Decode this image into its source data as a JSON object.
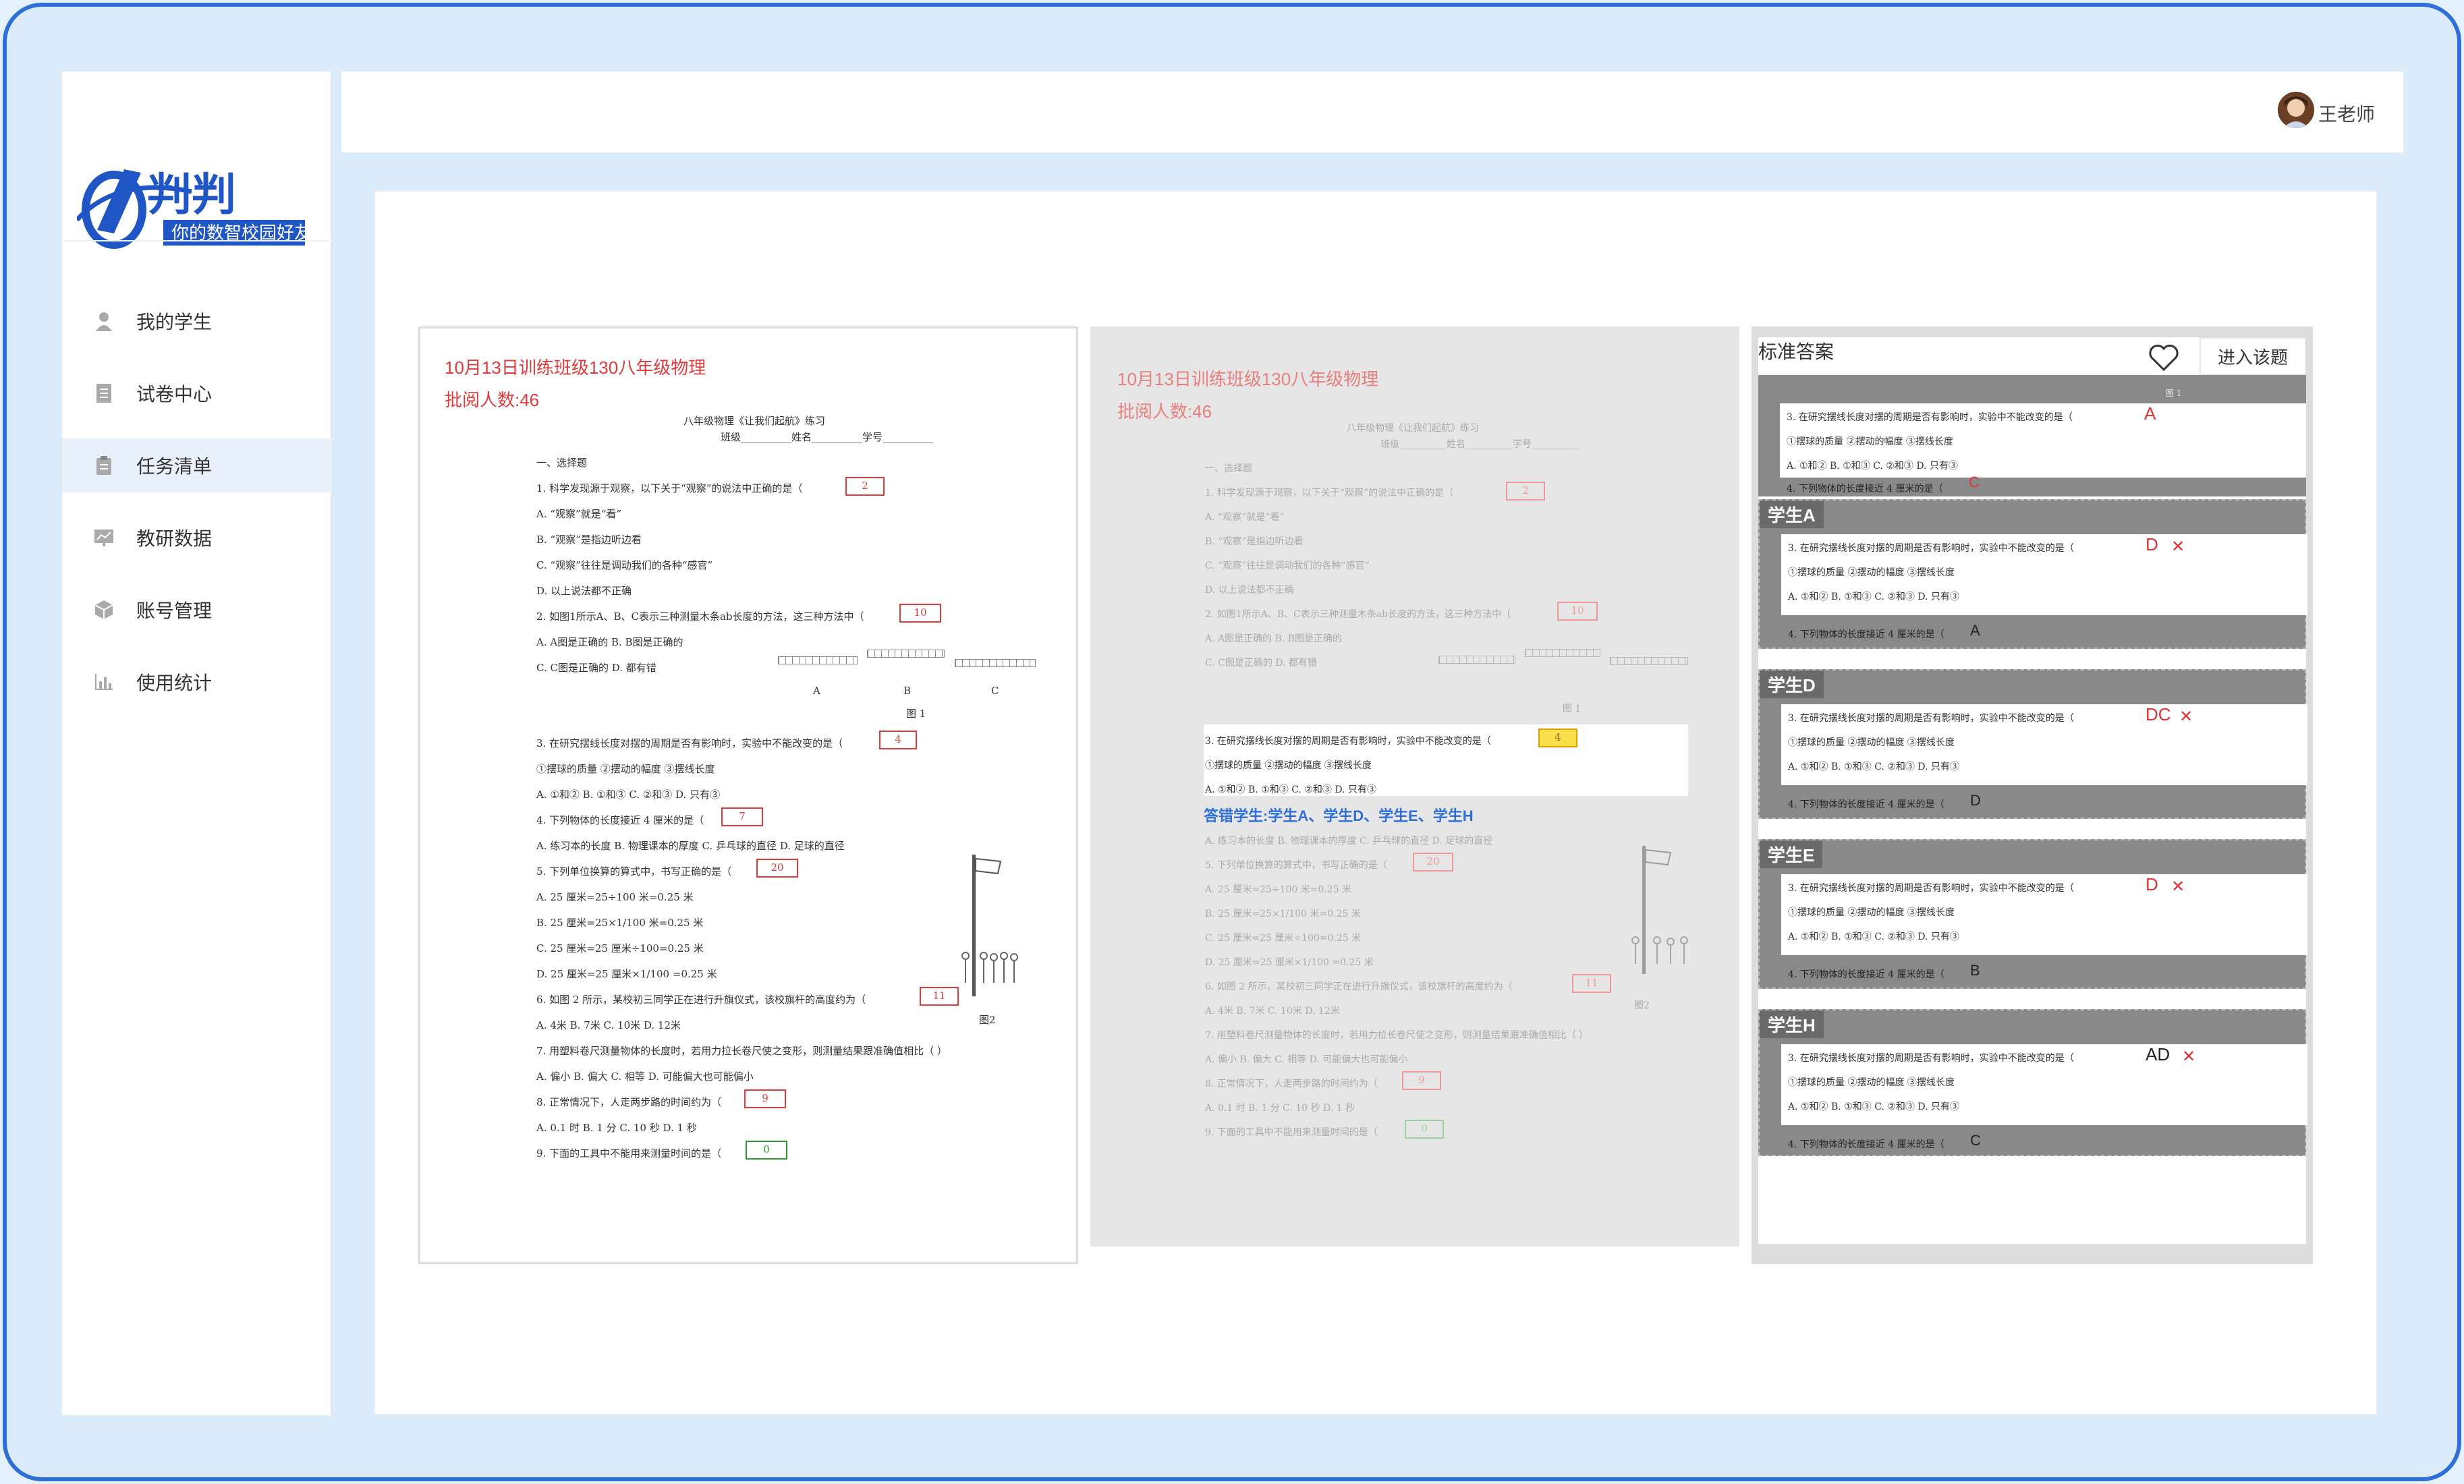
{
  "logo": {
    "brand": "判判",
    "slogan": "你的数智校园好友"
  },
  "user": {
    "name": "王老师"
  },
  "sidebar": {
    "items": [
      {
        "label": "我的学生",
        "icon": "person-icon"
      },
      {
        "label": "试卷中心",
        "icon": "document-icon"
      },
      {
        "label": "任务清单",
        "icon": "clipboard-icon",
        "active": true
      },
      {
        "label": "教研数据",
        "icon": "chart-board-icon"
      },
      {
        "label": "账号管理",
        "icon": "cube-icon"
      },
      {
        "label": "使用统计",
        "icon": "bar-chart-icon"
      }
    ]
  },
  "paper": {
    "title": "10月13日训练班级130八年级物理",
    "count": "批阅人数:46",
    "doc_title": "八年级物理《让我们起航》练习",
    "doc_sub": "班级__________姓名__________学号__________",
    "section": "一、选择题",
    "q1": "1.  科学发现源于观察，以下关于“观察”的说法中正确的是（",
    "q1a": "A.  “观察”就是“看”",
    "q1b": "B.  “观察”是指边听边看",
    "q1c": "C.  “观察”往往是调动我们的各种“感官”",
    "q1d": "D.  以上说法都不正确",
    "q2": "2.  如图1所示A、B、C表示三种测量木条ab长度的方法，这三种方法中（",
    "q2a": "A.  A图是正确的      B.  B图是正确的",
    "q2c": "C.  C图是正确的      D.  都有错",
    "fig1": "图 1",
    "fig_a": "A",
    "fig_b": "B",
    "fig_c": "C",
    "q3": "3.  在研究摆线长度对摆的周期是否有影响时，实验中不能改变的是（",
    "q3o": "①摆球的质量      ②摆动的幅度      ③摆线长度",
    "q3c": "A.  ①和②      B.  ①和③      C.  ②和③      D.  只有③",
    "q4": "4.  下列物体的长度接近 4 厘米的是（",
    "q4c": "A.  练习本的长度      B.  物理课本的厚度      C.  乒乓球的直径      D.  足球的直径",
    "q5": "5.  下列单位换算的算式中，书写正确的是（",
    "q5a": "A.  25 厘米=25÷100 米=0.25 米",
    "q5b": "B.  25 厘米=25×1/100 米=0.25 米",
    "q5c": "C.  25 厘米=25 厘米÷100=0.25 米",
    "q5d": "D.  25 厘米=25 厘米×1/100 =0.25 米",
    "q6": "6.  如图 2 所示，某校初三同学正在进行升旗仪式，该校旗杆的高度约为（",
    "q6c": "A.  4米      B.  7米      C.  10米      D.  12米",
    "fig2": "图2",
    "q7": "7.  用塑料卷尺测量物体的长度时，若用力拉长卷尺使之变形，则测量结果跟准确值相比（      ）",
    "q7c": "A.  偏小      B.  偏大      C.  相等      D.  可能偏大也可能偏小",
    "q8": "8.  正常情况下，人走两步路的时间约为（",
    "q8c": "A.  0.1 时      B.  1 分      C.  10 秒      D.  1 秒",
    "q9": "9.  下面的工具中不能用来测量时间的是（",
    "marks": {
      "q1": "2",
      "q2": "10",
      "q3": "4",
      "q4": "7",
      "q5": "20",
      "q6": "11",
      "q8": "9",
      "q9": "0"
    }
  },
  "wrong": "答错学生:学生A、学生D、学生E、学生H",
  "answers": {
    "title": "标准答案",
    "enter_label": "进入该题",
    "fig_label": "图 1",
    "q3": "3.  在研究摆线长度对摆的周期是否有影响时，实验中不能改变的是（",
    "q3o": "①摆球的质量      ②摆动的幅度      ③摆线长度",
    "q3c": "A.  ①和②      B.  ①和③      C.  ②和③      D.  只有③",
    "q4": "4.  下列物体的长度接近 4 厘米的是（",
    "std_ans": "A",
    "std_q4": "C",
    "students": [
      {
        "name": "学生A",
        "ans": "D",
        "q4": "A"
      },
      {
        "name": "学生D",
        "ans": "DC",
        "q4": "D"
      },
      {
        "name": "学生E",
        "ans": "D",
        "q4": "B"
      },
      {
        "name": "学生H",
        "ans": "AD",
        "q4": "C"
      }
    ],
    "wrong_mark": "✕"
  }
}
